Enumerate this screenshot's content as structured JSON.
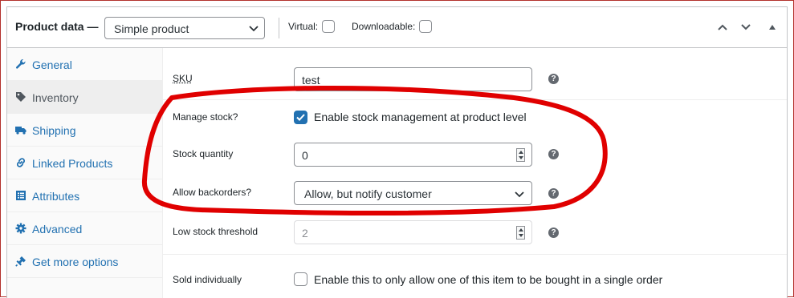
{
  "header": {
    "title": "Product data —",
    "product_type": "Simple product",
    "virtual_label": "Virtual:",
    "downloadable_label": "Downloadable:",
    "virtual_checked": false,
    "downloadable_checked": false,
    "icons": [
      "chevron-up-icon",
      "chevron-down-icon",
      "collapse-triangle-icon"
    ]
  },
  "sidebar": {
    "items": [
      {
        "label": "General",
        "icon": "wrench-icon",
        "active": false
      },
      {
        "label": "Inventory",
        "icon": "tag-icon",
        "active": true
      },
      {
        "label": "Shipping",
        "icon": "truck-icon",
        "active": false
      },
      {
        "label": "Linked Products",
        "icon": "link-icon",
        "active": false
      },
      {
        "label": "Attributes",
        "icon": "list-icon",
        "active": false
      },
      {
        "label": "Advanced",
        "icon": "gear-icon",
        "active": false
      },
      {
        "label": "Get more options",
        "icon": "plugin-icon",
        "active": false
      }
    ]
  },
  "inventory": {
    "sku_label": "SKU",
    "sku_value": "test",
    "manage_stock_label": "Manage stock?",
    "manage_stock_text": "Enable stock management at product level",
    "manage_stock_checked": true,
    "stock_qty_label": "Stock quantity",
    "stock_qty_value": "0",
    "backorders_label": "Allow backorders?",
    "backorders_value": "Allow, but notify customer",
    "low_stock_label": "Low stock threshold",
    "low_stock_value": "2",
    "sold_individually_label": "Sold individually",
    "sold_individually_text": "Enable this to only allow one of this item to be bought in a single order",
    "sold_individually_checked": false,
    "help_glyph": "?"
  },
  "colors": {
    "link": "#2271b1",
    "annotation": "#e00000",
    "border": "#c3c4c7"
  }
}
